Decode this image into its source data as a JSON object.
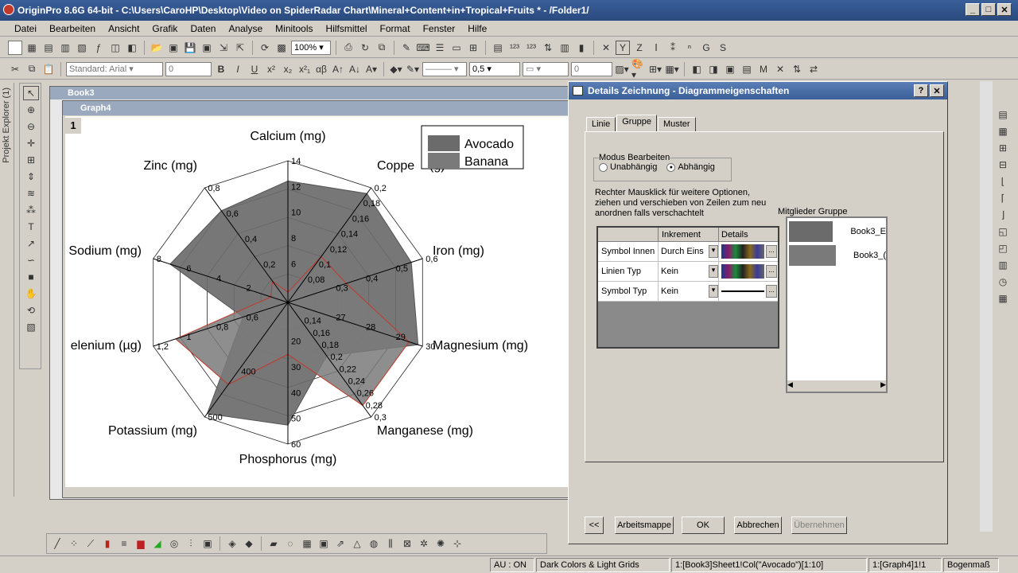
{
  "window": {
    "title": "OriginPro 8.6G 64-bit - C:\\Users\\CaroHP\\Desktop\\Video on SpiderRadar Chart\\Mineral+Content+in+Tropical+Fruits * - /Folder1/"
  },
  "menu": [
    "Datei",
    "Bearbeiten",
    "Ansicht",
    "Grafik",
    "Daten",
    "Analyse",
    "Minitools",
    "Hilfsmittel",
    "Format",
    "Fenster",
    "Hilfe"
  ],
  "toolbar": {
    "zoom": "100%",
    "font_style": "Standard: Arial",
    "font_size": "0",
    "line_width": "0,5",
    "num": "0"
  },
  "side": {
    "project_explorer": "Projekt Explorer (1)"
  },
  "book": {
    "title": "Book3"
  },
  "graph": {
    "title": "Graph4",
    "page": "1"
  },
  "chart_data": {
    "type": "radar",
    "axes": [
      "Calcium (mg)",
      "Copper (mg)",
      "Iron (mg)",
      "Magnesium (mg)",
      "Manganese (mg)",
      "Phosphorus (mg)",
      "Potassium (mg)",
      "Selenium (µg)",
      "Sodium (mg)",
      "Zinc (mg)"
    ],
    "axis_labels_visible": [
      "Calcium (mg)",
      "Coppe",
      "(g)",
      "Iron (mg)",
      "Magnesium (mg)",
      "Manganese (mg)",
      "Phosphorus (mg)",
      "Potassium (mg)",
      "elenium (µg)",
      "Sodium (mg)",
      "Zinc (mg)"
    ],
    "axis_max": [
      14,
      0.2,
      0.6,
      30,
      0.3,
      60,
      500,
      1.2,
      8,
      0.8
    ],
    "ticks": {
      "calcium": [
        "14",
        "12",
        "10",
        "8",
        "6"
      ],
      "copper": [
        "0,2",
        "0,18",
        "0,16",
        "0,14",
        "0,12",
        "0,1",
        "0,08"
      ],
      "iron": [
        "0,6",
        "0,5",
        "0,4",
        "0,3"
      ],
      "magnesium": [
        "30",
        "29",
        "28",
        "27"
      ],
      "manganese": [
        "0,3",
        "0,28",
        "0,26",
        "0,24",
        "0,22",
        "0,2",
        "0,18",
        "0,16",
        "0,14"
      ],
      "phosphorus": [
        "60",
        "50",
        "40",
        "30",
        "20"
      ],
      "potassium": [
        "500",
        "400"
      ],
      "selenium": [
        "1,2",
        "1",
        "0,8",
        "0,6"
      ],
      "sodium": [
        "8",
        "6",
        "4",
        "2"
      ],
      "zinc": [
        "0,8",
        "0,6",
        "0,4",
        "0,2"
      ]
    },
    "series": [
      {
        "name": "Avocado",
        "values": [
          12,
          0.19,
          0.55,
          29,
          0.14,
          52,
          485,
          0.4,
          7,
          0.64
        ],
        "color": "#6b6b6b"
      },
      {
        "name": "Banana",
        "values": [
          1,
          0.08,
          0.26,
          27,
          0.27,
          22,
          358,
          1.0,
          1,
          0.15
        ],
        "color": "#7a7a7a"
      }
    ]
  },
  "dialog": {
    "title": "Details Zeichnung - Diagrammeigenschaften",
    "tabs": [
      "Linie",
      "Gruppe",
      "Muster"
    ],
    "modus_label": "Modus Bearbeiten",
    "radio1": "Unabhängig",
    "radio2": "Abhängig",
    "hint": "Rechter Mausklick für weitere Optionen, ziehen und verschieben von Zeilen zum neu anordnen falls verschachtelt",
    "table_headers": [
      "",
      "Inkrement",
      "Details"
    ],
    "rows": [
      {
        "label": "Symbol Innen",
        "value": "Durch Eins"
      },
      {
        "label": "Linien Typ",
        "value": "Kein"
      },
      {
        "label": "Symbol Typ",
        "value": "Kein"
      }
    ],
    "members_label": "Mitglieder Gruppe",
    "members": [
      "Book3_E",
      "Book3_("
    ],
    "buttons": {
      "back": "<<",
      "workbook": "Arbeitsmappe",
      "ok": "OK",
      "cancel": "Abbrechen",
      "apply": "Übernehmen"
    }
  },
  "status": {
    "au": "AU : ON",
    "theme": "Dark Colors & Light Grids",
    "col": "1:[Book3]Sheet1!Col(\"Avocado\")[1:10]",
    "graph": "1:[Graph4]1!1",
    "unit": "Bogenmaß"
  }
}
